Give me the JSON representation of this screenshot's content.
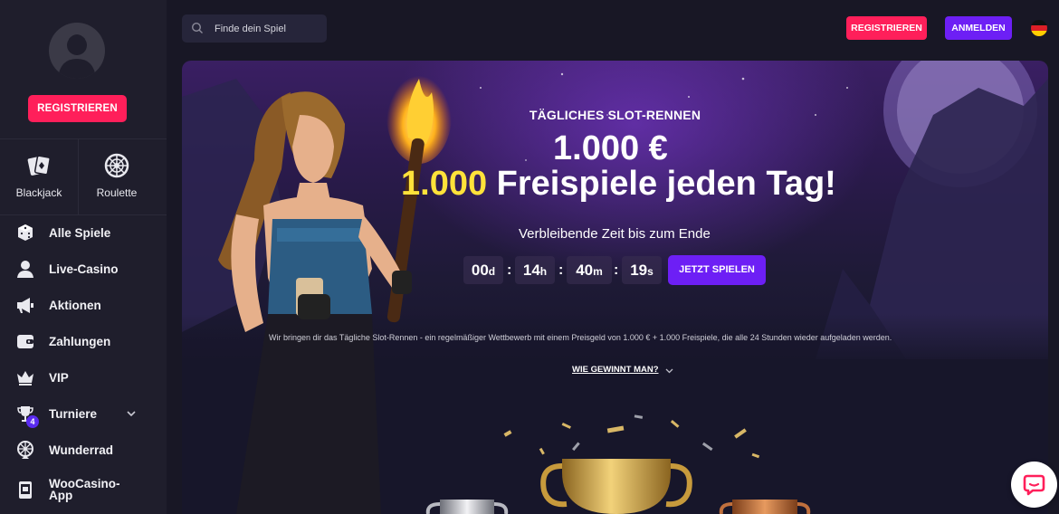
{
  "header": {
    "search_placeholder": "Finde dein Spiel",
    "register_label": "REGISTRIEREN",
    "login_label": "ANMELDEN",
    "language_flag": "german-flag-icon"
  },
  "sidebar": {
    "register_label": "REGISTRIEREN",
    "shortcuts": [
      {
        "label": "Blackjack",
        "icon": "cards-icon"
      },
      {
        "label": "Roulette",
        "icon": "roulette-icon"
      }
    ],
    "items": [
      {
        "label": "Alle Spiele",
        "icon": "dice-icon"
      },
      {
        "label": "Live-Casino",
        "icon": "dealer-icon"
      },
      {
        "label": "Aktionen",
        "icon": "megaphone-icon"
      },
      {
        "label": "Zahlungen",
        "icon": "wallet-icon"
      },
      {
        "label": "VIP",
        "icon": "crown-icon"
      },
      {
        "label": "Turniere",
        "icon": "trophy-icon",
        "badge": "4"
      },
      {
        "label": "Wunderrad",
        "icon": "wheel-icon"
      },
      {
        "label": "WooCasino-\nApp",
        "icon": "mobile-app-icon"
      }
    ]
  },
  "banner": {
    "title": "TÄGLICHES SLOT-RENNEN",
    "amount": "1.000 €",
    "freespins_number": "1.000",
    "freespins_text": "Freispiele jeden Tag!",
    "remaining_label": "Verbleibende Zeit bis zum Ende",
    "timer": {
      "days": "00",
      "days_unit": "d",
      "hours": "14",
      "hours_unit": "h",
      "minutes": "40",
      "minutes_unit": "m",
      "seconds": "19",
      "seconds_unit": "s"
    },
    "play_label": "JETZT SPIELEN",
    "description": "Wir bringen dir das Tägliche Slot-Rennen - ein regelmäßiger Wettbewerb mit einem Preisgeld von 1.000 € + 1.000 Freispiele, die alle 24 Stunden wieder aufgeladen werden.",
    "howto_label": "WIE GEWINNT MAN?"
  },
  "colors": {
    "register": "#ff1f5a",
    "primary": "#6d1ff5",
    "highlight": "#ffe23a",
    "background": "#181725",
    "sidebar": "#1f1e2c"
  }
}
